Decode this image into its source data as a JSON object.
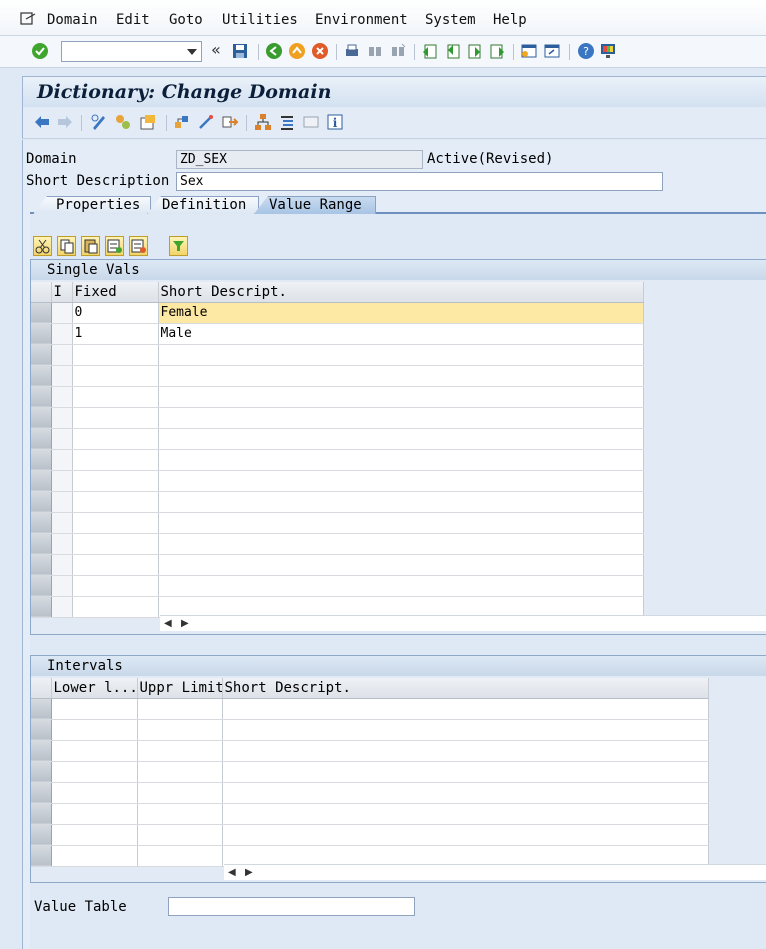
{
  "menu": {
    "items": [
      "Domain",
      "Edit",
      "Goto",
      "Utilities",
      "Environment",
      "System",
      "Help"
    ]
  },
  "toolbar": {
    "command_value": "",
    "icons": [
      "enter-icon",
      "back-icon",
      "exit-icon",
      "cancel-icon",
      "save-icon",
      "print-icon",
      "find-icon",
      "find-next-icon",
      "first-page-icon",
      "previous-page-icon",
      "next-page-icon",
      "last-page-icon",
      "new-session-icon",
      "shortcut-icon",
      "help-icon",
      "customize-layout-icon"
    ]
  },
  "title": "Dictionary: Change Domain",
  "form": {
    "domain_label": "Domain",
    "domain_value": "ZD_SEX",
    "status": "Active(Revised)",
    "short_desc_label": "Short Description",
    "short_desc_value": "Sex"
  },
  "tabs": [
    {
      "label": "Properties",
      "active": false
    },
    {
      "label": "Definition",
      "active": false
    },
    {
      "label": "Value Range",
      "active": true
    }
  ],
  "single_vals": {
    "title": "Single Vals",
    "columns": [
      "I",
      "Fixed",
      "Short Descript."
    ],
    "rows": [
      {
        "fixed": "0",
        "desc": "Female"
      },
      {
        "fixed": "1",
        "desc": "Male"
      }
    ]
  },
  "intervals": {
    "title": "Intervals",
    "columns": [
      "Lower l...",
      "Uppr Limit",
      "Short Descript."
    ]
  },
  "value_table": {
    "label": "Value Table",
    "value": ""
  },
  "colors": {
    "highlight_row": "#fde9a3",
    "background": "#dfe9f5"
  }
}
